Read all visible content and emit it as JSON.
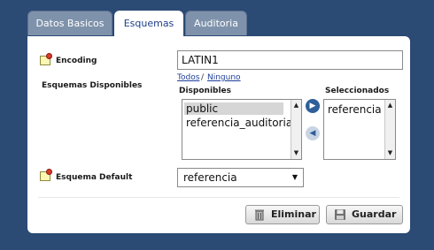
{
  "tabs": [
    {
      "label": "Datos Basicos",
      "active": false
    },
    {
      "label": "Esquemas",
      "active": true
    },
    {
      "label": "Auditoria",
      "active": false
    }
  ],
  "form": {
    "encoding": {
      "label": "Encoding",
      "value": "LATIN1"
    },
    "schemas": {
      "label": "Esquemas Disponibles",
      "select_all": "Todos",
      "separator": "/",
      "select_none": "Ninguno",
      "available_label": "Disponibles",
      "available": [
        "public",
        "referencia_auditoria"
      ],
      "selected_label": "Seleccionados",
      "selected": [
        "referencia"
      ]
    },
    "default_schema": {
      "label": "Esquema Default",
      "value": "referencia"
    }
  },
  "actions": {
    "delete_label": "Eliminar",
    "save_label": "Guardar"
  },
  "colors": {
    "background": "#2b4a74",
    "tab_inactive": "#7f92ab",
    "tab_active_text": "#1e3f8a"
  },
  "icons": {
    "field_marker": "note-pin-icon",
    "move_right": "arrow-right-icon",
    "move_left": "arrow-left-icon",
    "delete": "trash-icon",
    "save": "floppy-disk-icon"
  }
}
